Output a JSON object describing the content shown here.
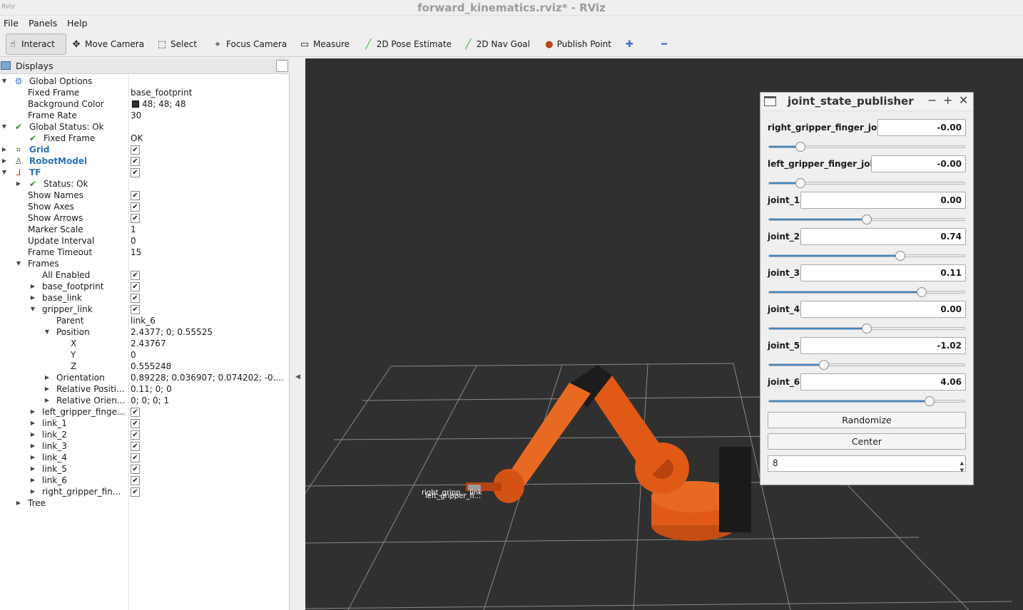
{
  "window": {
    "title": "forward_kinematics.rviz* - RViz",
    "app_icon_text": "RViz"
  },
  "menu": [
    "File",
    "Panels",
    "Help"
  ],
  "toolbar": [
    {
      "label": "Interact",
      "icon": "interact-icon",
      "glyph": "☝",
      "active": true
    },
    {
      "label": "Move Camera",
      "icon": "move-camera-icon",
      "glyph": "✥"
    },
    {
      "label": "Select",
      "icon": "select-icon",
      "glyph": "⬚"
    },
    {
      "label": "Focus Camera",
      "icon": "focus-camera-icon",
      "glyph": "⌖"
    },
    {
      "label": "Measure",
      "icon": "measure-icon",
      "glyph": "▭"
    },
    {
      "label": "2D Pose Estimate",
      "icon": "pose-estimate-icon",
      "glyph": "╱"
    },
    {
      "label": "2D Nav Goal",
      "icon": "nav-goal-icon",
      "glyph": "╱"
    },
    {
      "label": "Publish Point",
      "icon": "publish-point-icon",
      "glyph": "●"
    },
    {
      "label": "",
      "icon": "add-tool-icon",
      "glyph": "✚"
    },
    {
      "label": "",
      "icon": "remove-tool-icon",
      "glyph": "━"
    }
  ],
  "displays": {
    "title": "Displays",
    "rows": [
      {
        "ind": 0,
        "exp": "open",
        "icon": "gear",
        "key": "Global Options",
        "val": ""
      },
      {
        "ind": 1,
        "key": "Fixed Frame",
        "val": "base_footprint"
      },
      {
        "ind": 1,
        "key": "Background Color",
        "val": "48; 48; 48",
        "swatch": "#303030"
      },
      {
        "ind": 1,
        "key": "Frame Rate",
        "val": "30"
      },
      {
        "ind": 0,
        "exp": "open",
        "icon": "check",
        "key": "Global Status: Ok",
        "val": ""
      },
      {
        "ind": 1,
        "icon": "check",
        "key": "Fixed Frame",
        "val": "OK"
      },
      {
        "ind": 0,
        "exp": "closed",
        "icon": "grid",
        "key": "Grid",
        "val": "",
        "bold": true,
        "cb": true
      },
      {
        "ind": 0,
        "exp": "closed",
        "icon": "robot",
        "key": "RobotModel",
        "val": "",
        "bold": true,
        "cb": true
      },
      {
        "ind": 0,
        "exp": "open",
        "icon": "tf",
        "key": "TF",
        "val": "",
        "bold": true,
        "cb": true
      },
      {
        "ind": 1,
        "exp": "closed",
        "icon": "check",
        "key": "Status: Ok",
        "val": ""
      },
      {
        "ind": 1,
        "key": "Show Names",
        "val": "",
        "cb": true
      },
      {
        "ind": 1,
        "key": "Show Axes",
        "val": "",
        "cb": true
      },
      {
        "ind": 1,
        "key": "Show Arrows",
        "val": "",
        "cb": true
      },
      {
        "ind": 1,
        "key": "Marker Scale",
        "val": "1"
      },
      {
        "ind": 1,
        "key": "Update Interval",
        "val": "0"
      },
      {
        "ind": 1,
        "key": "Frame Timeout",
        "val": "15"
      },
      {
        "ind": 1,
        "exp": "open",
        "key": "Frames",
        "val": ""
      },
      {
        "ind": 2,
        "key": "All Enabled",
        "val": "",
        "cb": true
      },
      {
        "ind": 2,
        "exp": "closed",
        "key": "base_footprint",
        "val": "",
        "cb": true
      },
      {
        "ind": 2,
        "exp": "closed",
        "key": "base_link",
        "val": "",
        "cb": true
      },
      {
        "ind": 2,
        "exp": "open",
        "key": "gripper_link",
        "val": "",
        "cb": true
      },
      {
        "ind": 3,
        "key": "Parent",
        "val": "link_6"
      },
      {
        "ind": 3,
        "exp": "open",
        "key": "Position",
        "val": "2.4377; 0; 0.55525"
      },
      {
        "ind": 4,
        "key": "X",
        "val": "2.43767"
      },
      {
        "ind": 4,
        "key": "Y",
        "val": "0"
      },
      {
        "ind": 4,
        "key": "Z",
        "val": "0.555248"
      },
      {
        "ind": 3,
        "exp": "closed",
        "key": "Orientation",
        "val": "0.89228; 0.036907; 0.074202; -0...."
      },
      {
        "ind": 3,
        "exp": "closed",
        "key": "Relative Positi...",
        "val": "0.11; 0; 0"
      },
      {
        "ind": 3,
        "exp": "closed",
        "key": "Relative Orien...",
        "val": "0; 0; 0; 1"
      },
      {
        "ind": 2,
        "exp": "closed",
        "key": "left_gripper_finge...",
        "val": "",
        "cb": true
      },
      {
        "ind": 2,
        "exp": "closed",
        "key": "link_1",
        "val": "",
        "cb": true
      },
      {
        "ind": 2,
        "exp": "closed",
        "key": "link_2",
        "val": "",
        "cb": true
      },
      {
        "ind": 2,
        "exp": "closed",
        "key": "link_3",
        "val": "",
        "cb": true
      },
      {
        "ind": 2,
        "exp": "closed",
        "key": "link_4",
        "val": "",
        "cb": true
      },
      {
        "ind": 2,
        "exp": "closed",
        "key": "link_5",
        "val": "",
        "cb": true
      },
      {
        "ind": 2,
        "exp": "closed",
        "key": "link_6",
        "val": "",
        "cb": true
      },
      {
        "ind": 2,
        "exp": "closed",
        "key": "right_gripper_fin...",
        "val": "",
        "cb": true
      },
      {
        "ind": 1,
        "exp": "closed",
        "key": "Tree",
        "val": ""
      }
    ]
  },
  "viewport": {
    "bg": "#303030",
    "tf_labels": [
      "right_gripp... link",
      "left_gripper_fi..."
    ]
  },
  "jsp": {
    "title": "joint_state_publisher",
    "joints": [
      {
        "name": "right_gripper_finger_joint",
        "value": "-0.00",
        "frac": 0.16
      },
      {
        "name": "left_gripper_finger_joint",
        "value": "-0.00",
        "frac": 0.16
      },
      {
        "name": "joint_1",
        "value": "0.00",
        "frac": 0.5
      },
      {
        "name": "joint_2",
        "value": "0.74",
        "frac": 0.67
      },
      {
        "name": "joint_3",
        "value": "0.11",
        "frac": 0.78
      },
      {
        "name": "joint_4",
        "value": "0.00",
        "frac": 0.5
      },
      {
        "name": "joint_5",
        "value": "-1.02",
        "frac": 0.28
      },
      {
        "name": "joint_6",
        "value": "4.06",
        "frac": 0.82
      }
    ],
    "randomize_label": "Randomize",
    "center_label": "Center",
    "spin_value": "8"
  }
}
